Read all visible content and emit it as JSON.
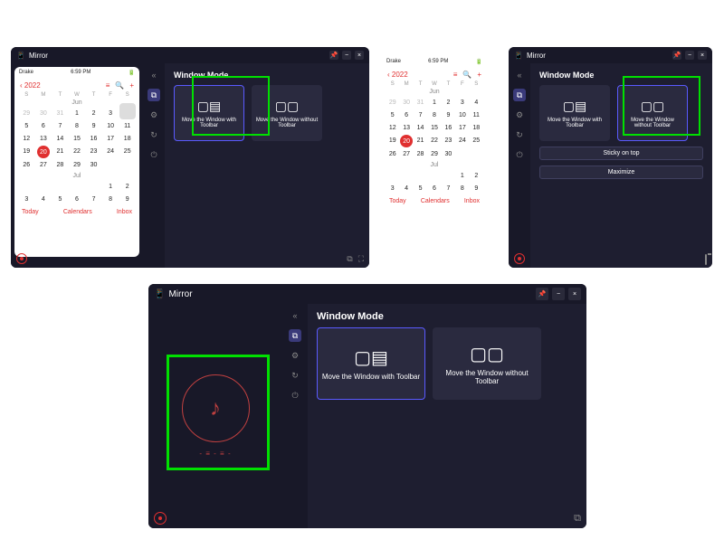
{
  "window1": {
    "title": "Mirror",
    "panel_title": "Window Mode",
    "card1": "Move the Window with Toolbar",
    "card2": "Move the Window without Toolbar"
  },
  "window2": {
    "title": "Mirror",
    "panel_title": "Window Mode",
    "card1": "Move the Window with Toolbar",
    "card2": "Move the Window without Toolbar",
    "btn1": "Sticky on top",
    "btn2": "Maximize"
  },
  "window3": {
    "title": "Mirror",
    "panel_title": "Window Mode",
    "card1": "Move the Window with Toolbar",
    "card2": "Move the Window without Toolbar"
  },
  "phone": {
    "carrier": "Drake",
    "time": "6:59 PM",
    "year": "2022",
    "month1": "Jun",
    "month2": "Jul",
    "days_of_week": [
      "S",
      "M",
      "T",
      "W",
      "T",
      "F",
      "S"
    ],
    "jun_rows": [
      [
        "29",
        "30",
        "31",
        "1",
        "2",
        "3",
        "4"
      ],
      [
        "5",
        "6",
        "7",
        "8",
        "9",
        "10",
        "11"
      ],
      [
        "12",
        "13",
        "14",
        "15",
        "16",
        "17",
        "18"
      ],
      [
        "19",
        "20",
        "21",
        "22",
        "23",
        "24",
        "25"
      ],
      [
        "26",
        "27",
        "28",
        "29",
        "30",
        "",
        ""
      ]
    ],
    "jul_rows": [
      [
        "",
        "",
        "",
        "",
        "",
        "1",
        "2"
      ],
      [
        "3",
        "4",
        "5",
        "6",
        "7",
        "8",
        "9"
      ]
    ],
    "today": "20",
    "foot": {
      "today": "Today",
      "calendars": "Calendars",
      "inbox": "Inbox"
    }
  }
}
